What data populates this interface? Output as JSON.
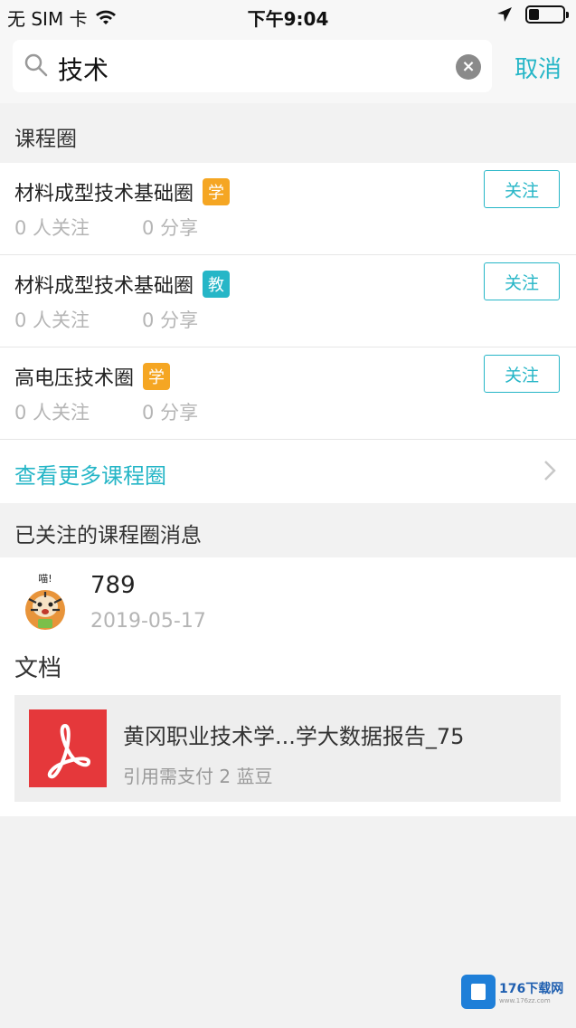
{
  "status_bar": {
    "carrier": "无 SIM 卡",
    "time": "下午9:04",
    "battery_level": 0.3
  },
  "search": {
    "query": "技术",
    "cancel_label": "取消"
  },
  "sections": {
    "course_circles": "课程圈",
    "followed_messages": "已关注的课程圈消息",
    "documents": "文档"
  },
  "circles": [
    {
      "name": "材料成型技术基础圈",
      "badge": "学",
      "badge_type": "student",
      "followers": "0 人关注",
      "shares": "0 分享",
      "follow_label": "关注"
    },
    {
      "name": "材料成型技术基础圈",
      "badge": "教",
      "badge_type": "teacher",
      "followers": "0 人关注",
      "shares": "0 分享",
      "follow_label": "关注"
    },
    {
      "name": "高电压技术圈",
      "badge": "学",
      "badge_type": "student",
      "followers": "0 人关注",
      "shares": "0 分享",
      "follow_label": "关注"
    }
  ],
  "more_link": "查看更多课程圈",
  "message": {
    "avatar_caption": "喵!",
    "title": "789",
    "date": "2019-05-17"
  },
  "document": {
    "title": "黄冈职业技术学...学大数据报告_75",
    "subtitle": "引用需支付 2 蓝豆"
  },
  "watermark": {
    "text": "176下载网",
    "url": "www.176zz.com"
  },
  "colors": {
    "accent": "#26b6c7",
    "student_badge": "#f5a623",
    "teacher_badge": "#26b6c7",
    "pdf": "#e5383b"
  }
}
